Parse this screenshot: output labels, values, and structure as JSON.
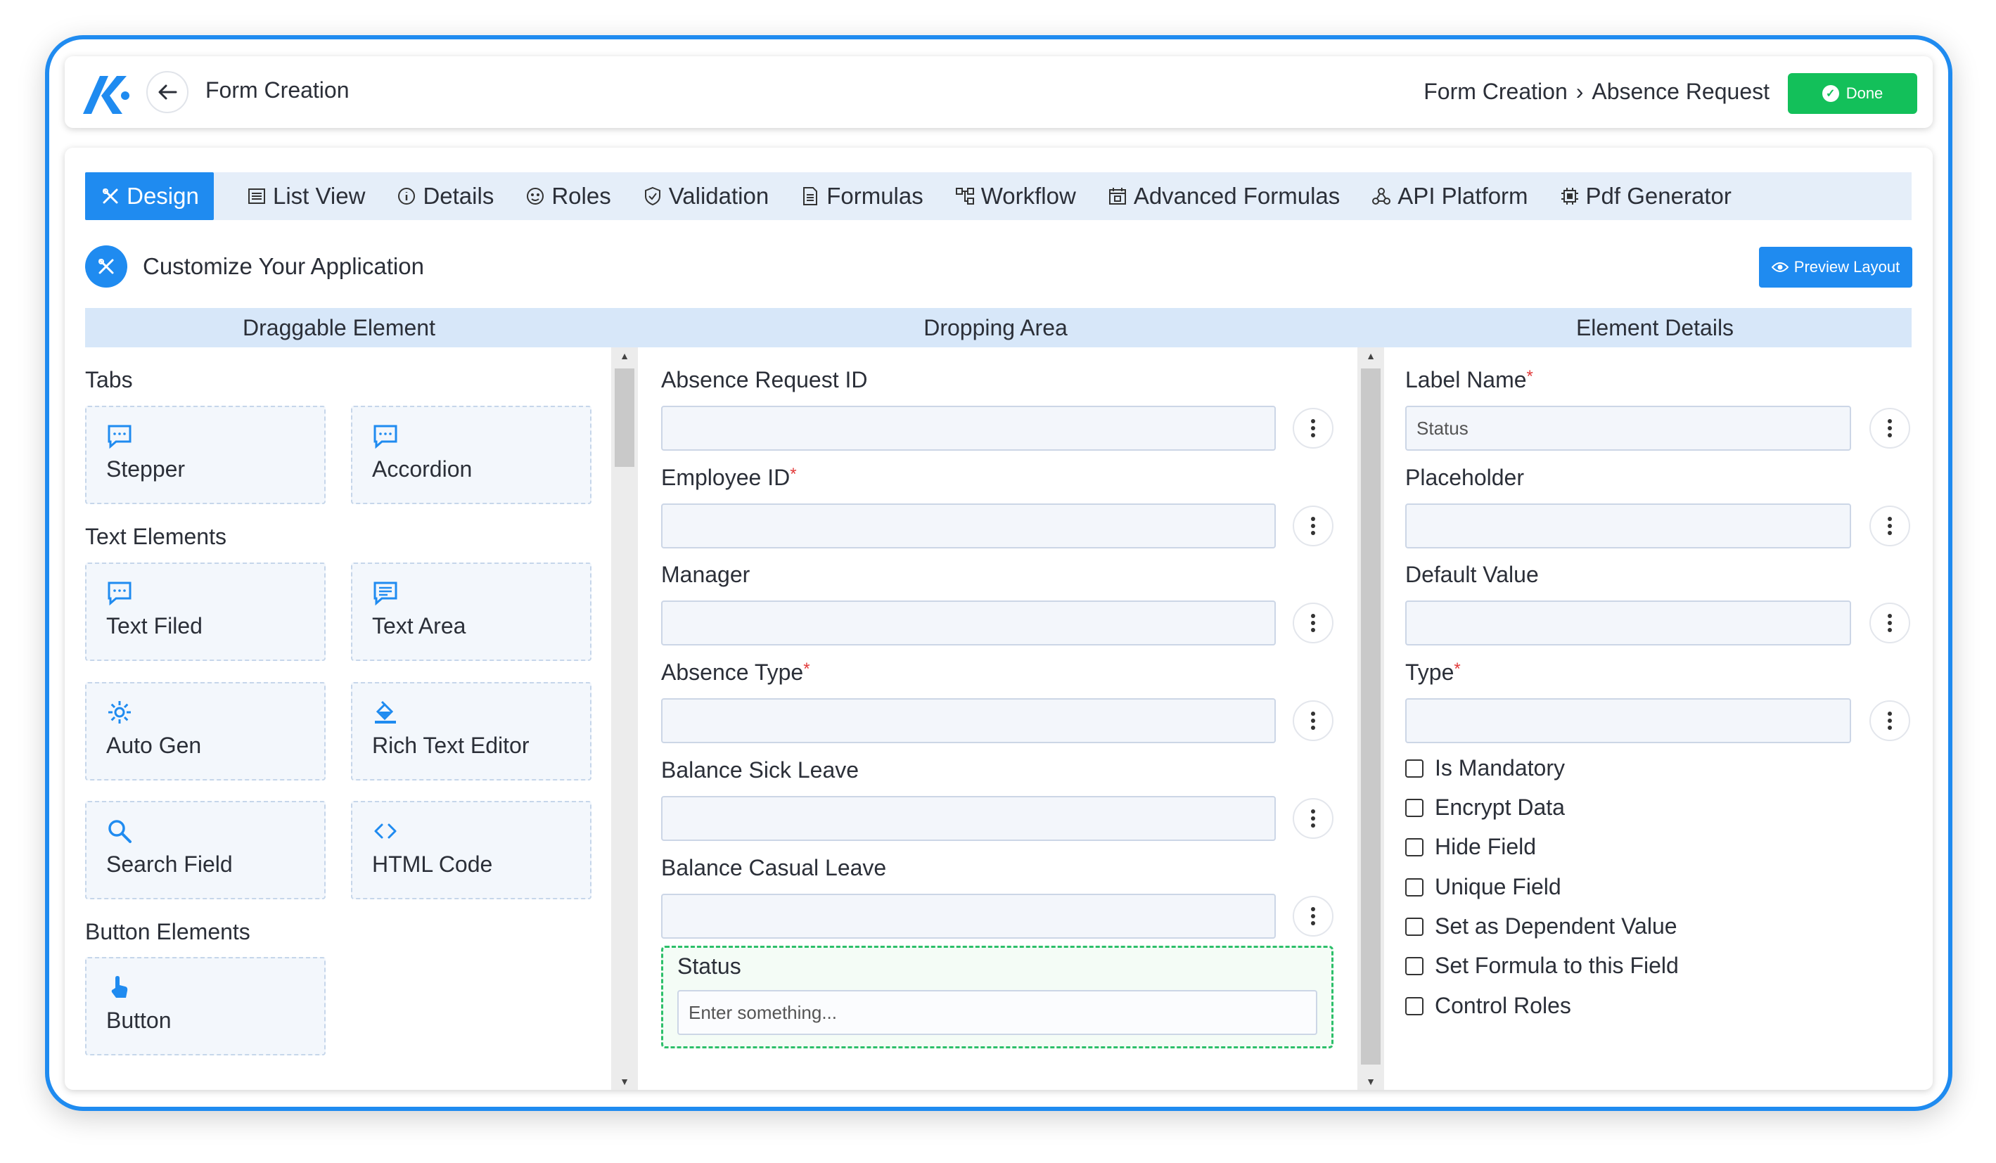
{
  "header": {
    "title": "Form Creation",
    "breadcrumb": [
      "Form Creation",
      "Absence Request"
    ],
    "breadcrumb_sep": "›",
    "done_label": "Done"
  },
  "tabs": [
    {
      "label": "Design",
      "icon": "design-icon",
      "active": true
    },
    {
      "label": "List View",
      "icon": "list-icon"
    },
    {
      "label": "Details",
      "icon": "info-icon"
    },
    {
      "label": "Roles",
      "icon": "roles-icon"
    },
    {
      "label": "Validation",
      "icon": "shield-check-icon"
    },
    {
      "label": "Formulas",
      "icon": "document-icon"
    },
    {
      "label": "Workflow",
      "icon": "workflow-icon"
    },
    {
      "label": "Advanced Formulas",
      "icon": "calendar-formula-icon"
    },
    {
      "label": "API Platform",
      "icon": "api-icon"
    },
    {
      "label": "Pdf Generator",
      "icon": "chip-icon"
    }
  ],
  "customize": {
    "title": "Customize Your Application",
    "preview_label": "Preview Layout"
  },
  "columns": {
    "draggable": "Draggable Element",
    "dropping": "Dropping Area",
    "details": "Element Details"
  },
  "draggable": {
    "sections": [
      {
        "title": "Tabs",
        "items": [
          {
            "label": "Stepper",
            "icon": "message-icon"
          },
          {
            "label": "Accordion",
            "icon": "message-icon"
          }
        ]
      },
      {
        "title": "Text Elements",
        "items": [
          {
            "label": "Text Filed",
            "icon": "message-icon"
          },
          {
            "label": "Text Area",
            "icon": "textarea-icon"
          },
          {
            "label": "Auto Gen",
            "icon": "gear-icon"
          },
          {
            "label": "Rich Text Editor",
            "icon": "paint-bucket-icon"
          },
          {
            "label": "Search Field",
            "icon": "search-icon"
          },
          {
            "label": "HTML Code",
            "icon": "code-icon"
          }
        ]
      },
      {
        "title": "Button Elements",
        "items": [
          {
            "label": "Button",
            "icon": "pointer-hand-icon"
          }
        ]
      }
    ]
  },
  "dropping": {
    "fields": [
      {
        "label": "Absence Request ID",
        "required": false
      },
      {
        "label": "Employee ID",
        "required": true
      },
      {
        "label": "Manager",
        "required": false
      },
      {
        "label": "Absence Type",
        "required": true
      },
      {
        "label": "Balance Sick Leave",
        "required": false
      },
      {
        "label": "Balance Casual Leave",
        "required": false
      }
    ],
    "selected": {
      "label": "Status",
      "placeholder": "Enter something..."
    }
  },
  "details": {
    "fields": [
      {
        "label": "Label Name",
        "required": true,
        "value": "Status"
      },
      {
        "label": "Placeholder",
        "required": false,
        "value": ""
      },
      {
        "label": "Default Value",
        "required": false,
        "value": ""
      },
      {
        "label": "Type",
        "required": true,
        "value": ""
      }
    ],
    "checkboxes": [
      "Is Mandatory",
      "Encrypt Data",
      "Hide Field",
      "Unique Field",
      "Set as Dependent Value",
      "Set Formula to this Field",
      "Control Roles"
    ]
  },
  "required_mark": "*",
  "colors": {
    "accent": "#1f8bf0",
    "success": "#13c05a",
    "selected_border": "#2dbf6a"
  }
}
